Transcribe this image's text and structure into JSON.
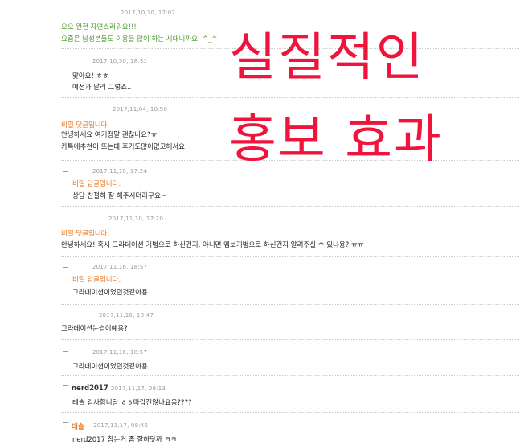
{
  "comments": [
    {
      "date": "2017,10,30, 17:07",
      "lines": [
        "오오 완전 자연스러워요!!!",
        "요즘은 남성분들도 이용을 많이 하는 시대니까요! ^_^"
      ]
    },
    {
      "date": "2017,10,30, 18:31",
      "lines": [
        "맞아요! ㅎㅎ",
        "예전과 달리 그렇죠.."
      ]
    },
    {
      "date": "2017,11,04, 10:50",
      "secret": "비밀 댓글입니다.",
      "lines": [
        "안녕하세요 여기정말 괜찮나요?ㅠ",
        "카톡에추천이 뜨는데 후기도많이없고해서요"
      ]
    },
    {
      "date": "2017,11,10, 17:24",
      "secret": "비밀 답글입니다.",
      "lines": [
        "상담 친절히 잘 해주시더라구요~"
      ]
    },
    {
      "date": "2017,11,10, 17:20",
      "secret": "비밀 댓글입니다.",
      "lines": [
        "안녕하세요! 혹시 그라데이션 기법으로 하신건지, 아니면 엠보기법으로 하신건지 알려주실 수 있나용? ㅠㅠ"
      ]
    },
    {
      "date": "2017,11,16, 18:57",
      "secret": "비밀 답글입니다.",
      "lines": [
        "그라데이션이였던것같아용"
      ]
    },
    {
      "date": "2017,11,16, 18:47",
      "lines": [
        "그라데이션눈썹이예용?"
      ]
    },
    {
      "date": "2017,11,16, 18:57",
      "lines": [
        "그라데이션이였던것같아용"
      ]
    },
    {
      "nick": "nerd2017",
      "date": "2017,11,17, 08:13",
      "lines": [
        "테솔  감사합니당 ㅎㅎ따갑진않나요옹????"
      ]
    },
    {
      "nick": "테솔",
      "date": "2017,11,17, 08:46",
      "lines": [
        "nerd2017  참는거 좀 잘하닷까 ㅋㅋ"
      ]
    }
  ],
  "overlay": {
    "line1": "실질적인",
    "line2": "홍보 효과"
  }
}
